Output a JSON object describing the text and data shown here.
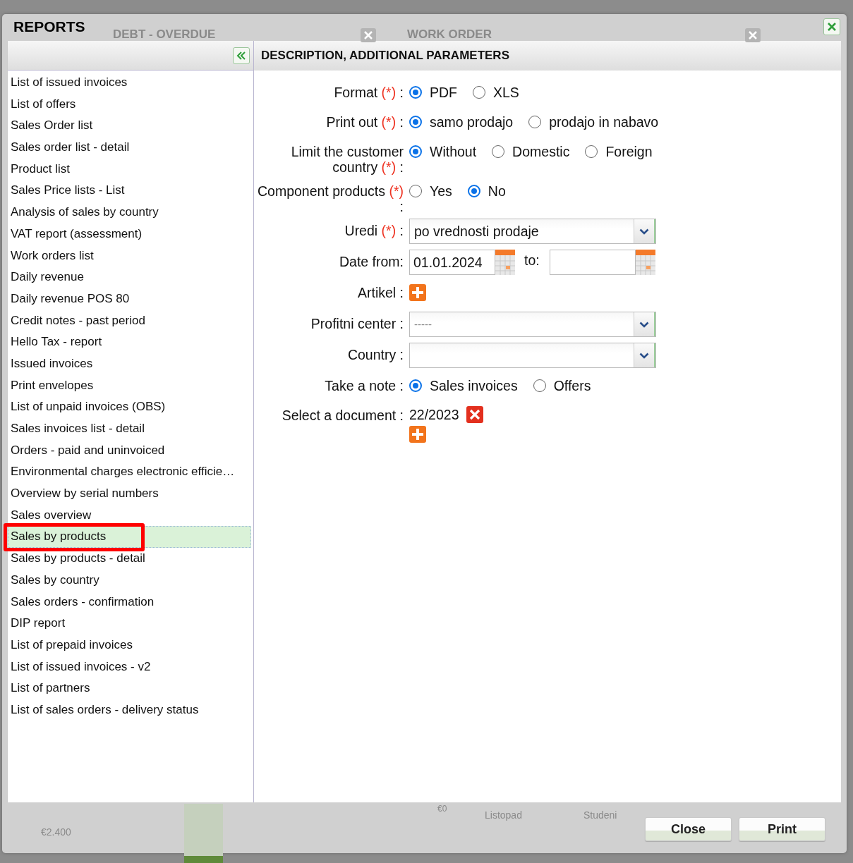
{
  "background": {
    "panels": [
      {
        "title": "DEBT - OVERDUE"
      },
      {
        "title": "WORK ORDER"
      }
    ],
    "axis_labels": [
      "€2.400",
      "€0",
      "Listopad",
      "Studeni"
    ]
  },
  "dialog": {
    "title": "REPORTS"
  },
  "sidebar": {
    "items": [
      {
        "label": "List of issued invoices",
        "selected": false,
        "highlighted": false
      },
      {
        "label": "List of offers",
        "selected": false,
        "highlighted": false
      },
      {
        "label": "Sales Order list",
        "selected": false,
        "highlighted": false
      },
      {
        "label": "Sales order list - detail",
        "selected": false,
        "highlighted": false
      },
      {
        "label": "Product list",
        "selected": false,
        "highlighted": false
      },
      {
        "label": "Sales Price lists - List",
        "selected": false,
        "highlighted": false
      },
      {
        "label": "Analysis of sales by country",
        "selected": false,
        "highlighted": false
      },
      {
        "label": "VAT report (assessment)",
        "selected": false,
        "highlighted": false
      },
      {
        "label": "Work orders list",
        "selected": false,
        "highlighted": false
      },
      {
        "label": "Daily revenue",
        "selected": false,
        "highlighted": false
      },
      {
        "label": "Daily revenue POS 80",
        "selected": false,
        "highlighted": false
      },
      {
        "label": "Credit notes - past period",
        "selected": false,
        "highlighted": false
      },
      {
        "label": "Hello Tax - report",
        "selected": false,
        "highlighted": false
      },
      {
        "label": "Issued invoices",
        "selected": false,
        "highlighted": false
      },
      {
        "label": "Print envelopes",
        "selected": false,
        "highlighted": false
      },
      {
        "label": "List of unpaid invoices (OBS)",
        "selected": false,
        "highlighted": false
      },
      {
        "label": "Sales invoices list - detail",
        "selected": false,
        "highlighted": false
      },
      {
        "label": "Orders - paid and uninvoiced",
        "selected": false,
        "highlighted": false
      },
      {
        "label": "Environmental charges electronic efficie…",
        "selected": false,
        "highlighted": false
      },
      {
        "label": "Overview by serial numbers",
        "selected": false,
        "highlighted": false
      },
      {
        "label": "Sales overview",
        "selected": false,
        "highlighted": false
      },
      {
        "label": "Sales by products",
        "selected": true,
        "highlighted": true
      },
      {
        "label": "Sales by products - detail",
        "selected": false,
        "highlighted": false
      },
      {
        "label": "Sales by country",
        "selected": false,
        "highlighted": false
      },
      {
        "label": "Sales orders - confirmation",
        "selected": false,
        "highlighted": false
      },
      {
        "label": "DIP report",
        "selected": false,
        "highlighted": false
      },
      {
        "label": "List of prepaid invoices",
        "selected": false,
        "highlighted": false
      },
      {
        "label": "List of issued invoices - v2",
        "selected": false,
        "highlighted": false
      },
      {
        "label": "List of partners",
        "selected": false,
        "highlighted": false
      },
      {
        "label": "List of sales orders - delivery status",
        "selected": false,
        "highlighted": false
      }
    ]
  },
  "panel": {
    "title": "DESCRIPTION, ADDITIONAL PARAMETERS",
    "fields": [
      {
        "kind": "radio",
        "label": "Format",
        "required_mark": "(*)",
        "suffix": ":",
        "options": [
          {
            "label": "PDF",
            "selected": true
          },
          {
            "label": "XLS",
            "selected": false
          }
        ]
      },
      {
        "kind": "radio",
        "label": "Print out",
        "required_mark": "(*)",
        "suffix": ":",
        "options": [
          {
            "label": "samo prodajo",
            "selected": true
          },
          {
            "label": "prodajo in nabavo",
            "selected": false
          }
        ]
      },
      {
        "kind": "radio",
        "label": "Limit the customer country",
        "required_mark": "(*)",
        "suffix": ":",
        "options": [
          {
            "label": "Without",
            "selected": true
          },
          {
            "label": "Domestic",
            "selected": false
          },
          {
            "label": "Foreign",
            "selected": false
          }
        ]
      },
      {
        "kind": "radio",
        "label": "Component products",
        "required_mark": "(*)",
        "suffix": ":",
        "options": [
          {
            "label": "Yes",
            "selected": false
          },
          {
            "label": "No",
            "selected": true
          }
        ]
      },
      {
        "kind": "select",
        "label": "Uredi",
        "required_mark": "(*)",
        "suffix": ":",
        "value": "po vrednosti prodaje"
      },
      {
        "kind": "daterange",
        "label": "Date from:",
        "value": "01.01.2024",
        "to_label": "to:"
      },
      {
        "kind": "add",
        "label": "Artikel",
        "suffix": ":"
      },
      {
        "kind": "select",
        "label": "Profitni center",
        "suffix": ":",
        "placeholder": "-----"
      },
      {
        "kind": "select",
        "label": "Country",
        "suffix": ":"
      },
      {
        "kind": "radio",
        "label": "Take a note",
        "suffix": ":",
        "options": [
          {
            "label": "Sales invoices",
            "selected": true
          },
          {
            "label": "Offers",
            "selected": false
          }
        ]
      },
      {
        "kind": "document",
        "label": "Select a document",
        "suffix": ":",
        "value": "22/2023"
      }
    ]
  },
  "buttons": [
    "Close",
    "Print"
  ]
}
